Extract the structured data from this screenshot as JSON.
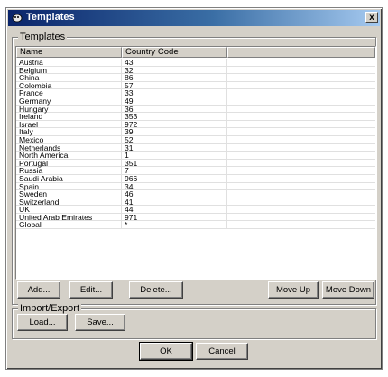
{
  "window": {
    "title": "Templates",
    "close_label": "x"
  },
  "templates_group": {
    "label": "Templates",
    "columns": [
      "Name",
      "Country Code"
    ],
    "rows": [
      [
        "Austria",
        "43"
      ],
      [
        "Belgium",
        "32"
      ],
      [
        "China",
        "86"
      ],
      [
        "Colombia",
        "57"
      ],
      [
        "France",
        "33"
      ],
      [
        "Germany",
        "49"
      ],
      [
        "Hungary",
        "36"
      ],
      [
        "Ireland",
        "353"
      ],
      [
        "Israel",
        "972"
      ],
      [
        "Italy",
        "39"
      ],
      [
        "Mexico",
        "52"
      ],
      [
        "Netherlands",
        "31"
      ],
      [
        "North America",
        "1"
      ],
      [
        "Portugal",
        "351"
      ],
      [
        "Russia",
        "7"
      ],
      [
        "Saudi Arabia",
        "966"
      ],
      [
        "Spain",
        "34"
      ],
      [
        "Sweden",
        "46"
      ],
      [
        "Switzerland",
        "41"
      ],
      [
        "UK",
        "44"
      ],
      [
        "United Arab Emirates",
        "971"
      ],
      [
        "Global",
        "*"
      ]
    ],
    "buttons": {
      "add": "Add...",
      "edit": "Edit...",
      "delete": "Delete...",
      "move_up": "Move Up",
      "move_down": "Move Down"
    }
  },
  "import_export_group": {
    "label": "Import/Export",
    "buttons": {
      "load": "Load...",
      "save": "Save..."
    }
  },
  "footer": {
    "ok": "OK",
    "cancel": "Cancel"
  }
}
